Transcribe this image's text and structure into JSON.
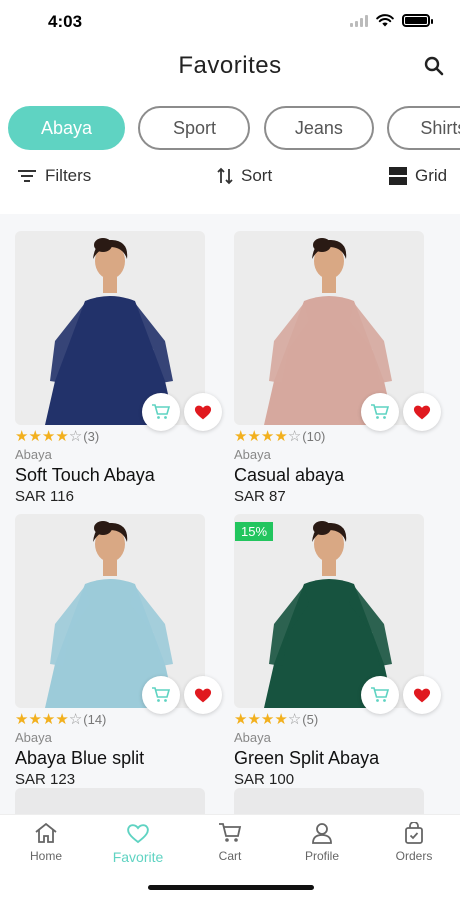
{
  "status": {
    "time": "4:03"
  },
  "header": {
    "title": "Favorites"
  },
  "chips": [
    {
      "label": "Abaya",
      "active": true
    },
    {
      "label": "Sport",
      "active": false
    },
    {
      "label": "Jeans",
      "active": false
    },
    {
      "label": "Shirts",
      "active": false
    }
  ],
  "toolbar": {
    "filters_label": "Filters",
    "sort_label": "Sort",
    "view_label": "Grid"
  },
  "products": [
    {
      "name": "Soft Touch Abaya",
      "category": "Abaya",
      "price": "SAR 116",
      "rating": 4,
      "reviews": "(3)",
      "dress_color": "#22326a",
      "bg_color": "#ececec",
      "discount": ""
    },
    {
      "name": "Casual abaya",
      "category": "Abaya",
      "price": "SAR 87",
      "rating": 4,
      "reviews": "(10)",
      "dress_color": "#d6a89e",
      "bg_color": "#ececec",
      "discount": ""
    },
    {
      "name": "Abaya Blue split",
      "category": "Abaya",
      "price": "SAR 123",
      "rating": 4,
      "reviews": "(14)",
      "dress_color": "#9ccbd9",
      "bg_color": "#ececec",
      "discount": ""
    },
    {
      "name": "Green Split Abaya",
      "category": "Abaya",
      "price": "SAR 100",
      "rating": 4,
      "reviews": "(5)",
      "dress_color": "#17533f",
      "bg_color": "#ececec",
      "discount": "15%"
    }
  ],
  "tabs": [
    {
      "label": "Home",
      "icon": "home-icon",
      "active": false
    },
    {
      "label": "Favorite",
      "icon": "heart-outline-icon",
      "active": true
    },
    {
      "label": "Cart",
      "icon": "cart-icon",
      "active": false
    },
    {
      "label": "Profile",
      "icon": "person-icon",
      "active": false
    },
    {
      "label": "Orders",
      "icon": "bag-check-icon",
      "active": false
    }
  ],
  "colors": {
    "accent": "#5fd3c2",
    "heart": "#e0191f",
    "star": "#f2b01e",
    "badge": "#22c55e"
  }
}
